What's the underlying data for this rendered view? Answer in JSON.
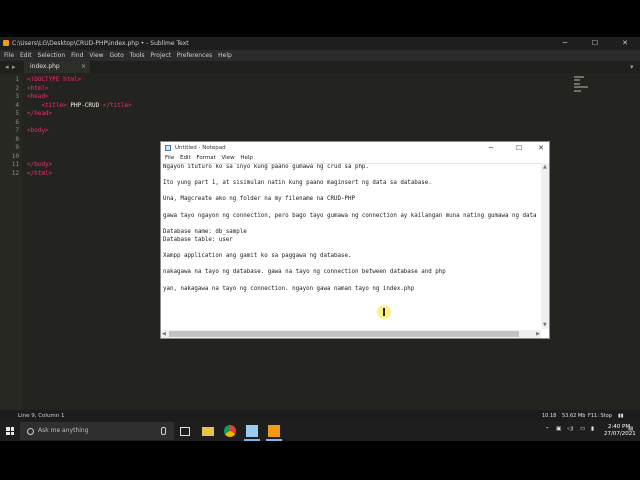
{
  "sublime": {
    "title": "C:\\Users\\LG\\Desktop\\CRUD-PHP\\index.php • - Sublime Text",
    "menu": [
      "File",
      "Edit",
      "Selection",
      "Find",
      "View",
      "Goto",
      "Tools",
      "Project",
      "Preferences",
      "Help"
    ],
    "tab": {
      "label": "index.php",
      "close": "×"
    },
    "line_numbers": [
      "1",
      "2",
      "3",
      "4",
      "5",
      "6",
      "7",
      "8",
      "9",
      "10",
      "11",
      "12"
    ],
    "code_lines": [
      {
        "indent": "",
        "tag": "<!DOCTYPE html>",
        "text": "",
        "tag2": ""
      },
      {
        "indent": "",
        "tag": "<html>",
        "text": "",
        "tag2": ""
      },
      {
        "indent": "",
        "tag": "<head>",
        "text": "",
        "tag2": ""
      },
      {
        "indent": "    ",
        "tag": "<title>",
        "text": " PHP-CRUD ",
        "tag2": "</title>"
      },
      {
        "indent": "",
        "tag": "</head>",
        "text": "",
        "tag2": ""
      },
      {
        "indent": "",
        "tag": "",
        "text": "",
        "tag2": ""
      },
      {
        "indent": "",
        "tag": "<body>",
        "text": "",
        "tag2": ""
      },
      {
        "indent": "",
        "tag": "",
        "text": "",
        "tag2": ""
      },
      {
        "indent": "",
        "tag": "",
        "text": "",
        "tag2": ""
      },
      {
        "indent": "",
        "tag": "</body>",
        "text": "",
        "tag2": ""
      },
      {
        "indent": "",
        "tag": "</html>",
        "text": "",
        "tag2": ""
      }
    ],
    "status": "Line 9, Column 1"
  },
  "notepad": {
    "title": "Untitled - Notepad",
    "menu": [
      "File",
      "Edit",
      "Format",
      "View",
      "Help"
    ],
    "lines": [
      "Ngayon ituturo ko sa inyo kung paano gumawa ng crud sa php.",
      "",
      "Ito yung part 1, at sisimulan natin kung paano maginsert ng data sa database.",
      "",
      "Una, Magcreate ako ng folder na my filename na CRUD-PHP",
      "",
      "gawa tayo ngayon ng connection, pero bago tayo gumawa ng connection ay kailangan muna nating gumawa ng data",
      "",
      "Database name: db_sample",
      "Database table: user",
      "",
      "Xampp application ang gamit ko sa paggawa ng database.",
      "",
      "nakagawa na tayo ng database. gawa na tayo ng connection between database and php",
      "",
      "yan, nakagawa na tayo ng connection. ngayon gawa naman tayo ng index.php"
    ]
  },
  "taskbar": {
    "search_placeholder": "Ask me anything",
    "tray": {
      "speed1": "10.18",
      "speed2": "53.62 Mb",
      "label": "F11: Stop"
    },
    "time": "2:40 PM",
    "date": "27/07/2021"
  },
  "colors": {
    "editor_bg": "#272822",
    "tag": "#f92672",
    "accent": "#7fb8e6"
  }
}
